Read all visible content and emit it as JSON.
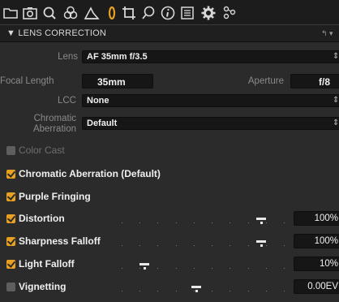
{
  "toolbar": {
    "tools": [
      {
        "icon": "folder-icon"
      },
      {
        "icon": "camera-icon"
      },
      {
        "icon": "search-icon"
      },
      {
        "icon": "color-circles-icon"
      },
      {
        "icon": "exposure-icon"
      },
      {
        "icon": "lens-icon",
        "active": true,
        "color": "#e8a020"
      },
      {
        "icon": "crop-icon"
      },
      {
        "icon": "local-adjust-icon"
      },
      {
        "icon": "info-icon"
      },
      {
        "icon": "metadata-icon"
      },
      {
        "icon": "gear-icon"
      },
      {
        "icon": "batch-icon"
      }
    ]
  },
  "section": {
    "title": "▼ LENS CORRECTION",
    "reset_label": "↰ ▾"
  },
  "lens": {
    "label": "Lens",
    "value": "AF 35mm f/3.5"
  },
  "focal_length": {
    "label": "Focal Length",
    "value": "35mm"
  },
  "aperture": {
    "label": "Aperture",
    "value": "f/8"
  },
  "lcc": {
    "label": "LCC",
    "value": "None"
  },
  "chromatic": {
    "label_line1": "Chromatic",
    "label_line2": "Aberration",
    "value": "Default"
  },
  "checkboxes": {
    "color_cast": {
      "label": "Color Cast",
      "checked": false
    },
    "chromatic_aberration": {
      "label": "Chromatic Aberration (Default)",
      "checked": true
    },
    "purple_fringing": {
      "label": "Purple Fringing",
      "checked": true
    }
  },
  "sliders": [
    {
      "label": "Distortion",
      "checked": true,
      "value_text": "100%",
      "level": 1.0
    },
    {
      "label": "Sharpness Falloff",
      "checked": true,
      "value_text": "100%",
      "level": 1.0
    },
    {
      "label": "Light Falloff",
      "checked": true,
      "value_text": "10%",
      "level": 0.1
    },
    {
      "label": "Vignetting",
      "checked": false,
      "value_text": "0.00EV",
      "level": 0.5
    }
  ],
  "colors": {
    "accent": "#e8a020",
    "background": "#2b2b2b",
    "toolbar": "#1c1c1c"
  }
}
